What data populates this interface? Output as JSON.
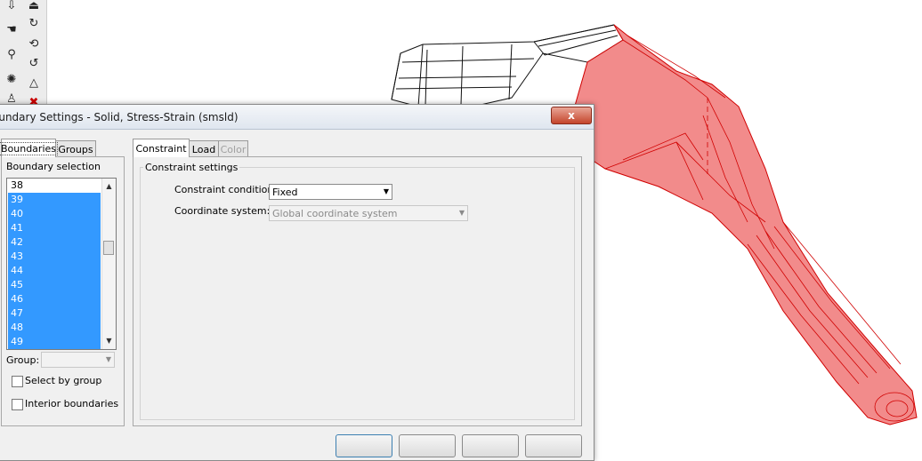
{
  "dialog": {
    "title": "oundary Settings - Solid, Stress-Strain (smsld)",
    "close_label": "x"
  },
  "left_tabs": [
    {
      "label": "Boundaries",
      "active": true
    },
    {
      "label": "Groups",
      "active": false
    }
  ],
  "boundary_selection": {
    "title": "Boundary selection",
    "items": [
      {
        "label": "38",
        "selected": false
      },
      {
        "label": "39",
        "selected": true
      },
      {
        "label": "40",
        "selected": true
      },
      {
        "label": "41",
        "selected": true
      },
      {
        "label": "42",
        "selected": true
      },
      {
        "label": "43",
        "selected": true
      },
      {
        "label": "44",
        "selected": true
      },
      {
        "label": "45",
        "selected": true
      },
      {
        "label": "46",
        "selected": true
      },
      {
        "label": "47",
        "selected": true
      },
      {
        "label": "48",
        "selected": true
      },
      {
        "label": "49",
        "selected": true
      }
    ],
    "group_label": "Group:",
    "group_value": "",
    "select_by_group_label": "Select by group",
    "select_by_group_checked": false,
    "interior_boundaries_label": "Interior boundaries",
    "interior_boundaries_checked": false
  },
  "right_tabs": [
    {
      "label": "Constraint",
      "active": true,
      "enabled": true
    },
    {
      "label": "Load",
      "active": false,
      "enabled": true
    },
    {
      "label": "Color",
      "active": false,
      "enabled": false
    }
  ],
  "constraint_settings": {
    "title": "Constraint settings",
    "condition_label": "Constraint condition:",
    "condition_value": "Fixed",
    "coord_label": "Coordinate system:",
    "coord_value": "Global coordinate system"
  },
  "toolbar_icons": [
    "arrow-down-icon",
    "eraser-icon",
    "hand-icon",
    "rotate-icon",
    "stack-icon",
    "refresh-icon",
    "light-icon",
    "triangle-icon",
    "person-icon",
    "cross-icon"
  ],
  "colors": {
    "selection": "#3399ff",
    "model_highlight": "#f28b8b",
    "model_edge": "#d00000",
    "close_button": "#c4452c"
  }
}
